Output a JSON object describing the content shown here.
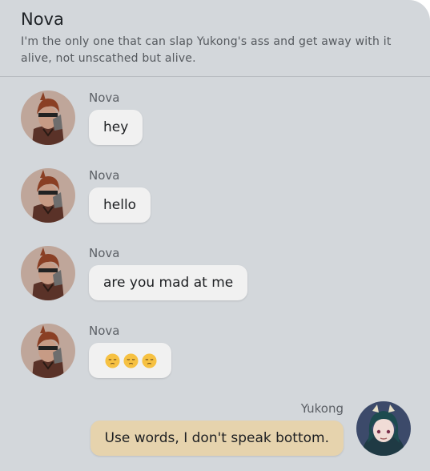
{
  "header": {
    "name": "Nova",
    "status": "I'm the only one that can slap Yukong's ass and get away with it alive, not unscathed but alive."
  },
  "messages": [
    {
      "sender": "Nova",
      "text": "hey"
    },
    {
      "sender": "Nova",
      "text": "hello"
    },
    {
      "sender": "Nova",
      "text": "are you mad at me"
    },
    {
      "sender": "Nova",
      "text": "😔😔😔"
    },
    {
      "sender": "Yukong",
      "text": "Use words, I don't speak bottom."
    }
  ],
  "colors": {
    "background": "#d3d7db",
    "bubble": "#f1f1f1",
    "own_bubble": "#e6d3ad"
  }
}
